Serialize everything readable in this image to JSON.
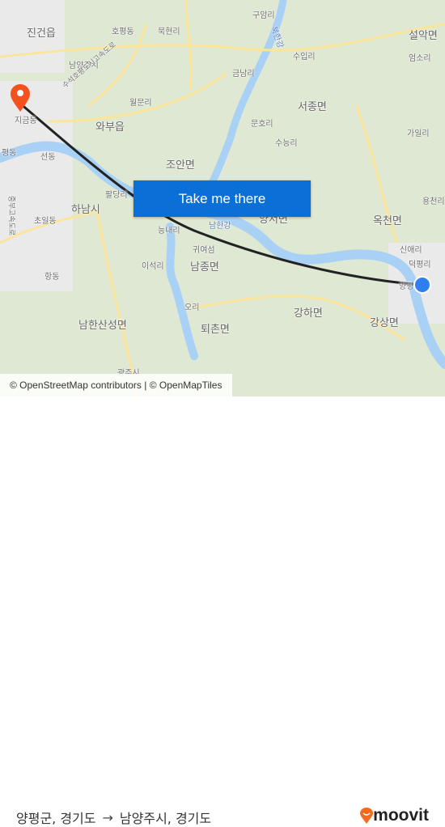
{
  "map": {
    "labels": [
      "진건읍",
      "호평동",
      "묵현리",
      "남양주시",
      "수석호평도시고속도로",
      "월문리",
      "와부읍",
      "지금동",
      "조안면",
      "평동",
      "선동",
      "구암리",
      "북한강",
      "수입리",
      "금남리",
      "설악면",
      "엄소리",
      "서종면",
      "문호리",
      "수능리",
      "가일리",
      "하남시",
      "초일동",
      "팔당리",
      "능내리",
      "남한강",
      "귀여섬",
      "이석리",
      "남종면",
      "항동",
      "오리",
      "남한산성면",
      "퇴촌면",
      "광주시",
      "옥천면",
      "용천리",
      "신애리",
      "덕평리",
      "양평",
      "강하면",
      "강상면",
      "양서면",
      "중부고속도로"
    ],
    "origin_color": "#f4511e",
    "destination_color": "#2f7ff0",
    "route_color": "#222222"
  },
  "cta": {
    "label": "Take me there",
    "color": "#0a6fd6"
  },
  "attribution": "© OpenStreetMap contributors | © OpenMapTiles",
  "footer": {
    "from": "양평군, 경기도",
    "arrow": "→",
    "to": "남양주시, 경기도",
    "brand": "moovit",
    "brand_color": "#f26b21"
  }
}
